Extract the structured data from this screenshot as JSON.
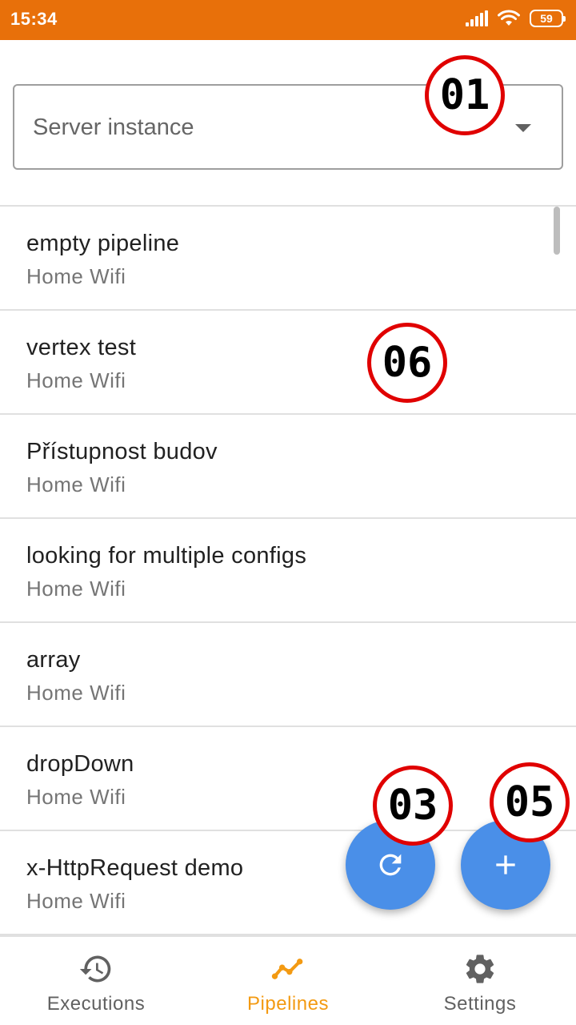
{
  "status_bar": {
    "time": "15:34",
    "battery": "59",
    "icons": [
      "signal-icon",
      "wifi-icon",
      "battery-icon"
    ]
  },
  "server_select": {
    "placeholder": "Server instance",
    "icon": "dropdown-arrow-icon"
  },
  "pipelines": [
    {
      "name": "empty pipeline",
      "server": "Home Wifi"
    },
    {
      "name": "vertex test",
      "server": "Home Wifi"
    },
    {
      "name": "Přístupnost budov",
      "server": "Home Wifi"
    },
    {
      "name": "looking for multiple configs",
      "server": "Home Wifi"
    },
    {
      "name": "array",
      "server": "Home Wifi"
    },
    {
      "name": "dropDown",
      "server": "Home Wifi"
    },
    {
      "name": "x-HttpRequest demo",
      "server": "Home Wifi"
    }
  ],
  "fabs": {
    "refresh_icon": "refresh-icon",
    "add_icon": "add-icon",
    "color": "#4A8FE8"
  },
  "annotations": {
    "a01": "01",
    "a03": "03",
    "a05": "05",
    "a06": "06"
  },
  "bottom_nav": {
    "items": [
      {
        "label": "Executions",
        "icon": "history-icon",
        "active": false
      },
      {
        "label": "Pipelines",
        "icon": "pipeline-chart-icon",
        "active": true
      },
      {
        "label": "Settings",
        "icon": "gear-icon",
        "active": false
      }
    ]
  },
  "colors": {
    "status_bar": "#E8700A",
    "accent": "#F39A12",
    "fab": "#4A8FE8",
    "annotation": "#E00000"
  }
}
